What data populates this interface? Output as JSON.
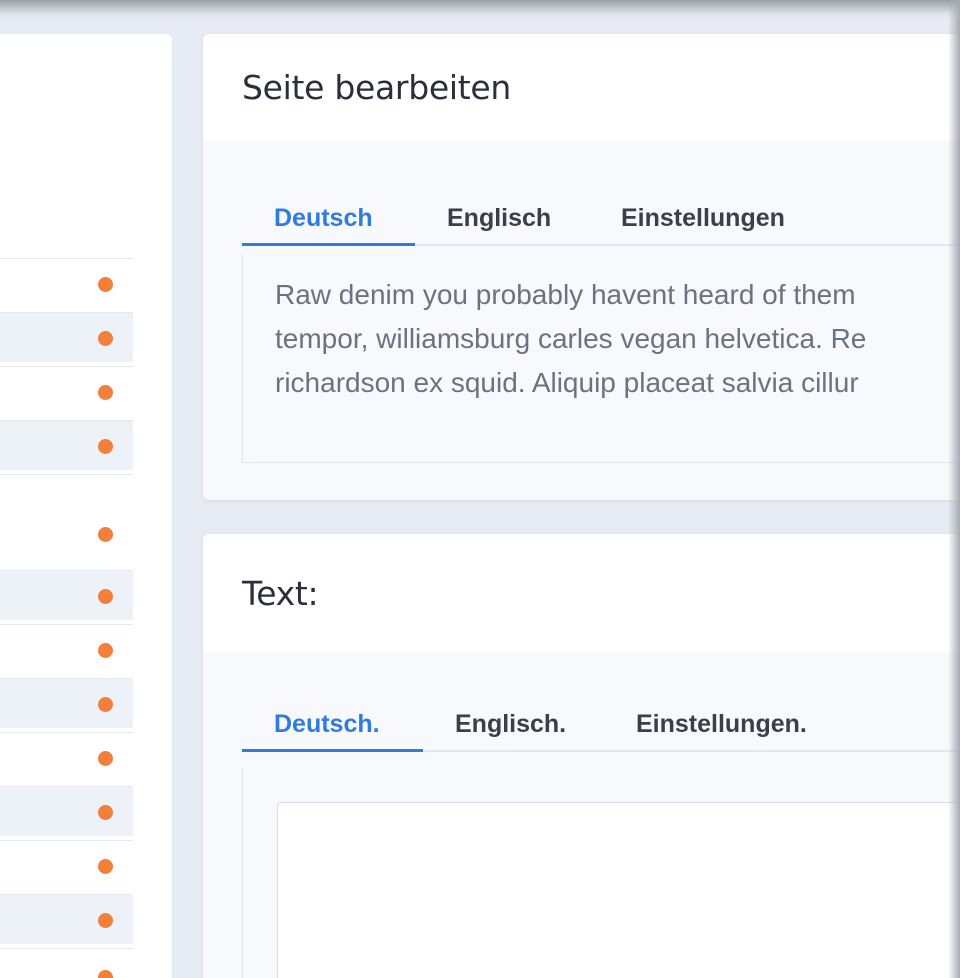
{
  "card1": {
    "title": "Seite bearbeiten",
    "tabs": [
      {
        "label": "Deutsch",
        "active": true
      },
      {
        "label": "Englisch",
        "active": false
      },
      {
        "label": "Einstellungen",
        "active": false
      }
    ],
    "paragraph_lines": [
      "Raw denim you probably havent heard of them",
      "tempor, williamsburg carles vegan helvetica. Re",
      "richardson ex squid. Aliquip placeat salvia cillur"
    ]
  },
  "card2": {
    "title": "Text:",
    "tabs": [
      {
        "label": "Deutsch.",
        "active": true
      },
      {
        "label": "Englisch.",
        "active": false
      },
      {
        "label": "Einstellungen.",
        "active": false
      }
    ],
    "editor_value": ""
  },
  "left_list": {
    "row_count": 14,
    "status_dot_color": "#f47f3a"
  },
  "colors": {
    "accent": "#2f7be0",
    "status_dot": "#f47f3a",
    "page_bg": "#e7ecf4"
  }
}
